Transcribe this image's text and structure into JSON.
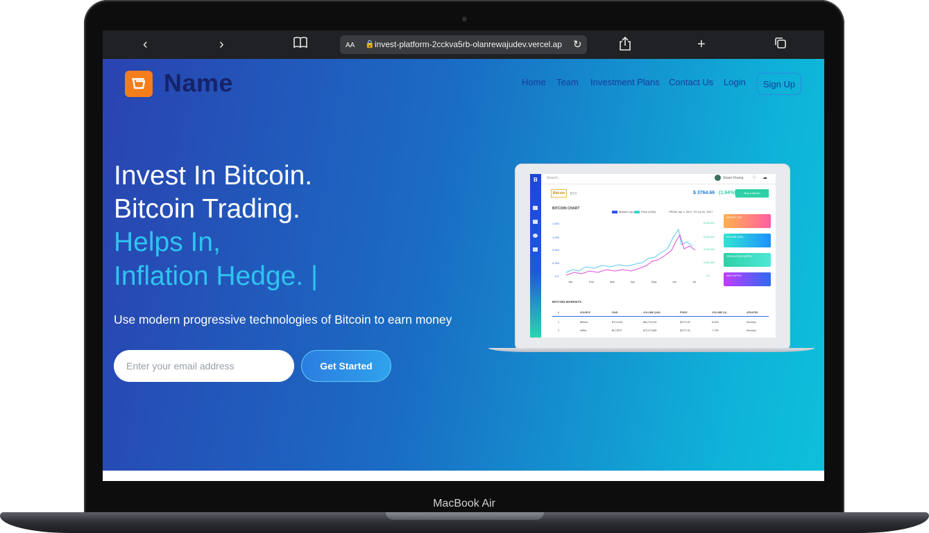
{
  "device": {
    "label": "MacBook Air"
  },
  "browser": {
    "back_icon": "chevron-left-icon",
    "forward_icon": "chevron-right-icon",
    "bookmarks_icon": "book-icon",
    "text_size": "AA",
    "url": "invest-platform-2cckva5rb-olanrewajudev.vercel.ap",
    "reload_icon": "reload-icon",
    "share_icon": "share-icon",
    "new_tab_icon": "plus-icon",
    "tabs_icon": "tabs-icon"
  },
  "header": {
    "brand": "Name",
    "logo_icon": "basket-icon",
    "nav": [
      "Home",
      "Team",
      "Investment Plans",
      "Contact Us",
      "Login"
    ],
    "signup": "Sign Up"
  },
  "hero": {
    "line1": "Invest In Bitcoin.",
    "line2": "Bitcoin Trading.",
    "line3": "Helps In,",
    "line4": "Inflation Hedge. |",
    "subtext": "Use modern progressive technologies of Bitcoin to earn money",
    "email_placeholder": "Enter your email address",
    "cta": "Get Started"
  },
  "mockup": {
    "sidebar_letter": "B",
    "search_placeholder": "Search...",
    "user_name": "Stuart Hoang",
    "coin_tag": "Bitcoin",
    "coin_sub": "BTC",
    "price": "$ 3764.66",
    "change": "(1.94%)",
    "action_button": "Buy a bitcoin",
    "chart_title": "BITCOIN CHART",
    "legend": [
      "Market Cap",
      "Price (USD)"
    ],
    "date_range": "FROM Jan 1, 2017 TO Jul 31, 2017",
    "y_ticks": [
      "1,500",
      "1,000",
      "0.500",
      "0.250",
      "0.0"
    ],
    "x_ticks": [
      "Jan",
      "Feb",
      "Mar",
      "Apr",
      "May",
      "Jun",
      "Jul"
    ],
    "right_ticks": [
      "8,000,000",
      "6,000,000",
      "4,000,000",
      "2,000,000",
      "0.0"
    ],
    "cards": [
      "MARKET CAP",
      "VOLUME (24H)",
      "CIRCULATING SUPPLY",
      "MAX SUPPLY"
    ],
    "card_colors": [
      "#ff9f43",
      "#1e90ff",
      "#2ee6b0",
      "#c13cff"
    ],
    "markets_title": "BITCOIN MARKETS",
    "table_headers": [
      "#",
      "SOURCE",
      "PAIR",
      "VOLUME (24H)",
      "PRICE",
      "VOLUME (%)",
      "UPDATED"
    ],
    "table_rows": [
      [
        "1",
        "Bitfinex",
        "BTC/USD",
        "$84,793,200",
        "$3770.00",
        "8.92%",
        "Recently"
      ],
      [
        "2",
        "HitBtc",
        "BLC/BTC",
        "$73,073,860",
        "$3772.44",
        "7.79%",
        "Recently"
      ]
    ]
  },
  "colors": {
    "brand_orange": "#f47d1c",
    "brand_navy": "#15236a",
    "accent_cyan": "#2fc4f0",
    "hero_start": "#2a43b0",
    "hero_end": "#0ec0da"
  }
}
